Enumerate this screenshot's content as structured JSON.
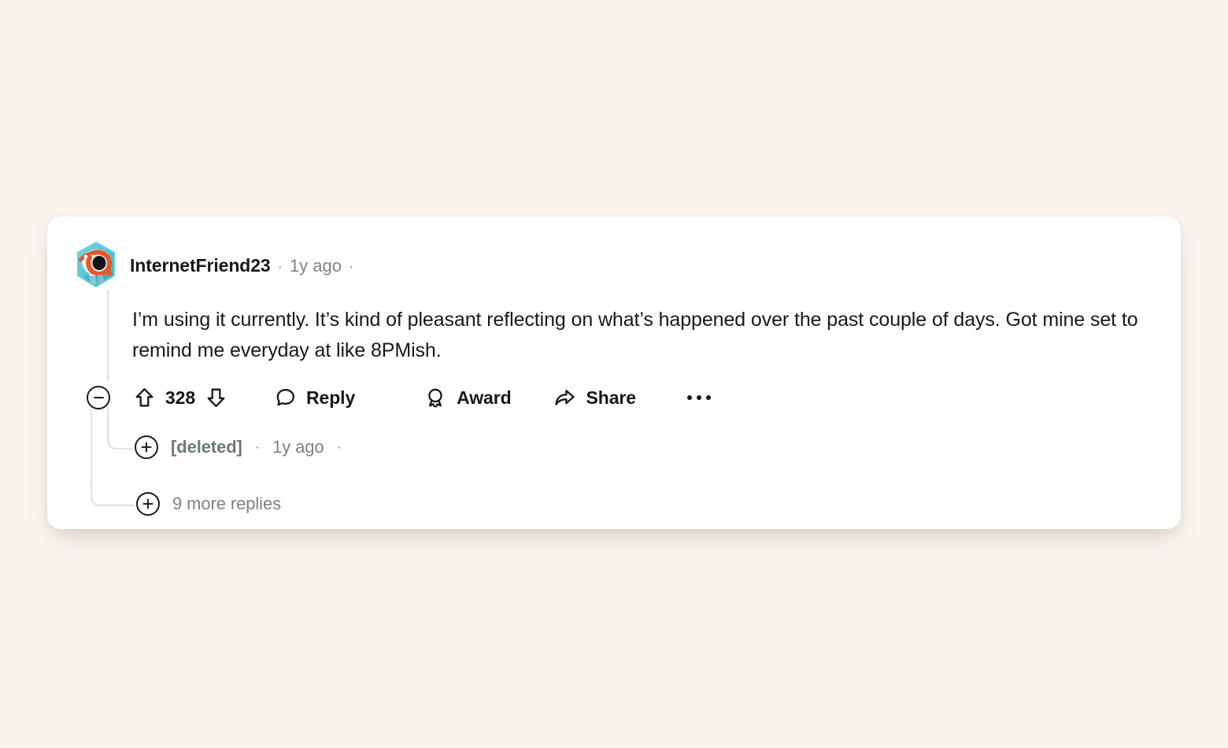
{
  "page": {
    "background_color": "#faf4ef",
    "card_background": "#ffffff"
  },
  "comment": {
    "author": "InternetFriend23",
    "separator_dot": "·",
    "timestamp": "1y ago",
    "trailing_dot": "·",
    "avatar_icon": "reddit-snoo-avatar",
    "body": "I’m using it currently. It’s kind of pleasant reflecting on what’s happened over the past couple of days. Got mine set to remind me everyday at like 8PMish.",
    "actions": {
      "collapse_icon": "minus-circle-icon",
      "upvote_icon": "upvote-arrow-icon",
      "score": "328",
      "downvote_icon": "downvote-arrow-icon",
      "reply_icon": "speech-bubble-icon",
      "reply_label": "Reply",
      "award_icon": "award-badge-icon",
      "award_label": "Award",
      "share_icon": "share-arrow-icon",
      "share_label": "Share",
      "overflow_icon": "ellipsis-icon"
    }
  },
  "replies": [
    {
      "expand_icon": "plus-circle-icon",
      "author": "[deleted]",
      "separator_dot": "·",
      "timestamp": "1y ago",
      "trailing_dot": "·"
    },
    {
      "expand_icon": "plus-circle-icon",
      "label": "9 more replies"
    }
  ],
  "colors": {
    "text_primary": "#15191c",
    "text_muted": "#7c8287",
    "deleted_author": "#6b7880",
    "thread_line": "#e6e4e2"
  }
}
